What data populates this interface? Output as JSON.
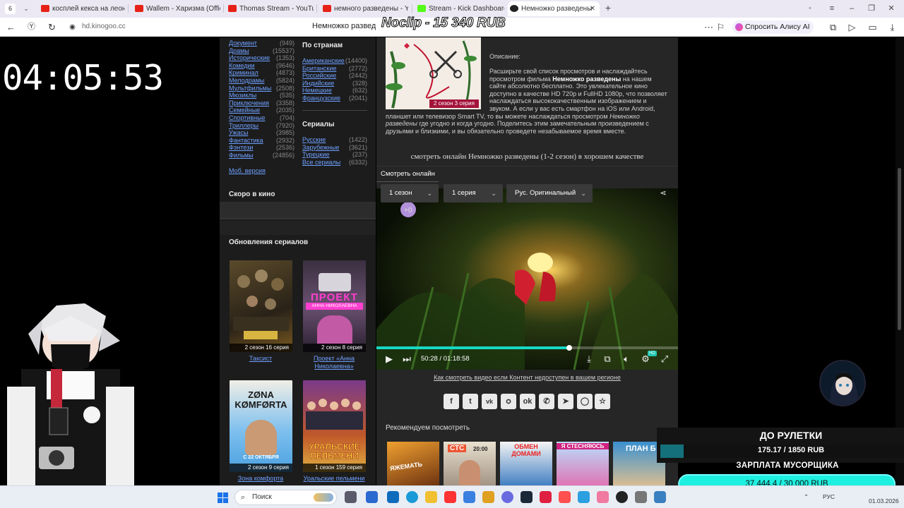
{
  "browser": {
    "tab_count": "6",
    "tabs": [
      {
        "label": "косплей кекса на леона -",
        "fav": "#e62117"
      },
      {
        "label": "Wallem - Харизма (Officia",
        "fav": "#e62117"
      },
      {
        "label": "Thomas Stream - YouTube",
        "fav": "#e62117"
      },
      {
        "label": "немного разведены - You",
        "fav": "#e62117"
      },
      {
        "label": "Stream - Kick Dashboard",
        "fav": "#53fc18"
      },
      {
        "label": "Немножко разведены",
        "fav": "#222222"
      }
    ],
    "url": "hd.kinogoo.cc",
    "page_title": "Немножко разведены",
    "alice_label": "Спросить Алису AI"
  },
  "stream_overlay": {
    "noclip": "Noclip - 15 340 RUB",
    "timer": "04:05:53",
    "roulette_title": "ДО РУЛЕТКИ",
    "roulette_value": "175.17 / 1850 RUB",
    "roulette_progress": 0.0947,
    "salary_title": "ЗАРПЛАТА МУСОРЩИКА",
    "salary_value": "37 444.4 / 30 000 RUB"
  },
  "sidebar": {
    "genres": [
      {
        "label": "Документ",
        "count": "(949)"
      },
      {
        "label": "Драмы",
        "count": "(15537)"
      },
      {
        "label": "Исторические",
        "count": "(1353)"
      },
      {
        "label": "Комедии",
        "count": "(9646)"
      },
      {
        "label": "Криминал",
        "count": "(4873)"
      },
      {
        "label": "Мелодрамы",
        "count": "(5824)"
      },
      {
        "label": "Мультфильмы",
        "count": "(2508)"
      },
      {
        "label": "Мюзиклы",
        "count": "(535)"
      },
      {
        "label": "Приключения",
        "count": "(3358)"
      },
      {
        "label": "Семейные",
        "count": "(2035)"
      },
      {
        "label": "Спортивные",
        "count": "(704)"
      },
      {
        "label": "Триллеры",
        "count": "(7920)"
      },
      {
        "label": "Ужасы",
        "count": "(3985)"
      },
      {
        "label": "Фантастика",
        "count": "(2932)"
      },
      {
        "label": "Фэнтези",
        "count": "(2536)"
      },
      {
        "label": "Фильмы",
        "count": "(24856)"
      }
    ],
    "countries_title": "По странам",
    "countries": [
      {
        "label": "Американские",
        "count": "(14400)"
      },
      {
        "label": "Британские",
        "count": "(2772)"
      },
      {
        "label": "Российские",
        "count": "(2442)"
      },
      {
        "label": "Индийские",
        "count": "(328)"
      },
      {
        "label": "Немецкие",
        "count": "(632)"
      },
      {
        "label": "Французские",
        "count": "(2041)"
      }
    ],
    "serials_title": "Сериалы",
    "serials": [
      {
        "label": "Русские",
        "count": "(1422)"
      },
      {
        "label": "Зарубежные",
        "count": "(3621)"
      },
      {
        "label": "Турецкие",
        "count": "(237)"
      },
      {
        "label": "Все сериалы",
        "count": "(6332)"
      }
    ],
    "mobile_version": "Моб. версия",
    "soon_title": "Скоро в кино",
    "updates_title": "Обновления сериалов",
    "posters": [
      {
        "badge": "2 сезон 16 серия",
        "caption": "Таксист"
      },
      {
        "badge": "2 сезон 8 серия",
        "caption": "Проект «Анна Николаевна»",
        "poster_text": "ПРОЕКТ",
        "poster_sub": "АННА НИКОЛАЕВНА"
      },
      {
        "badge": "2 сезон 9 серия",
        "caption": "Зона комфорта",
        "poster_text": "ZØNA KØMFØRTA",
        "poster_sub": "С 22 ОКТЯБРЯ"
      },
      {
        "badge": "1 сезон 159 серия",
        "caption": "Уральские пельмени",
        "poster_text": "УРАЛЬСКИЕ ПЕЛЬМЕНИ"
      }
    ]
  },
  "main": {
    "cover_badge": "2 сезон 3 серия",
    "description_label": "Описание:",
    "description_parts": [
      "Расширьте свой список просмотров и наслаждайтесь просмотром фильма ",
      "Немножко разведены",
      " на нашем сайте абсолютно бесплатно. Это увлекательное кино доступно в качестве HD 720p и FullHD 1080p, что позволяет наслаждаться высококачественным изображением и звуком. А если у вас есть смартфон на iOS или Android, планшет или телевизор Smart TV, то вы можете наслаждаться просмотром ",
      "Немножко разведены",
      " где угодно и когда угодно. Поделитесь этим замечательным произведением с друзьями и близкими, и вы обязательно проведете незабываемое время вместе."
    ],
    "watch_heading": "смотреть онлайн Немножко разведены (1-2 сезон) в хорошем качестве",
    "player_tab": "Смотреть онлайн",
    "season_select": "1 сезон",
    "episode_select": "1 серия",
    "voice_select": "Рус. Оригинальный",
    "timecode": "50:28 / 01:18:58",
    "progress": 0.639,
    "hd_badge": "HD",
    "unavailable_link": "Как смотреть видео если Контент недоступен в вашем регионе",
    "recommend_title": "Рекомендуем посмотреть",
    "recommendations": [
      {
        "title": "ЯЖЕМАТЬ"
      },
      {
        "title": "СТС",
        "sub": "20:00"
      },
      {
        "title": "ОБМЕН ДОМАМИ"
      },
      {
        "title": "Я СТЕСНЯЮСЬ"
      },
      {
        "title": "ПЛАН Б"
      }
    ]
  },
  "taskbar": {
    "search_label": "Поиск",
    "language": "РУС",
    "date": "01.03.2026"
  }
}
